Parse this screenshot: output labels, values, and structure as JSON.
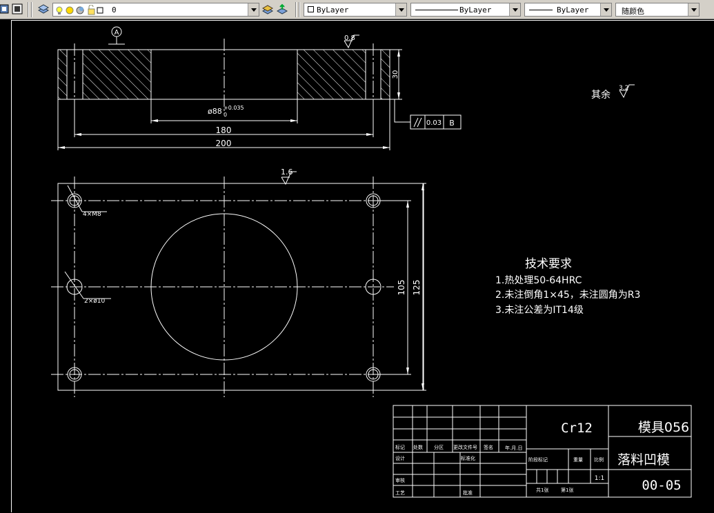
{
  "toolbar": {
    "layer_name": "0",
    "color_value": "ByLayer",
    "linetype_value": "ByLayer",
    "lineweight_value": "ByLayer",
    "plotstyle_value": "随颜色"
  },
  "drawing": {
    "datum_label": "A",
    "roughness_top": "0.8",
    "roughness_front": "1.6",
    "roughness_other_label": "其余",
    "roughness_other": "3.2",
    "dim_bore_main": "ø88",
    "dim_bore_tol_upper": "+0.035",
    "dim_bore_tol_lower": "0",
    "dim_180": "180",
    "dim_200": "200",
    "dim_30": "30",
    "tolerance_value": "0.03",
    "tolerance_datum": "B",
    "dim_105": "105",
    "dim_125": "125",
    "label_holes_thread": "4×M8",
    "label_holes_pin": "2×ø10",
    "tech_title": "技术要求",
    "tech_items": [
      "1.热处理50-64HRC",
      "2.未注倒角1×45，未注圆角为R3",
      "3.未注公差为IT14级"
    ]
  },
  "title_block": {
    "material": "Cr12",
    "drawing_code": "模具056",
    "part_name": "落料凹模",
    "drawing_number": "00-05",
    "scale": "1:1",
    "row_labels": {
      "biaoji": "标记",
      "chushu": "处数",
      "fenqu": "分区",
      "gengai": "更改文件号",
      "qianming": "签名",
      "riqi": "年.月.日",
      "sheji": "设计",
      "biaozhunhua": "标准化",
      "shenhe": "审核",
      "gongyi": "工艺",
      "pizhun": "批准",
      "jieduan": "阶段标记",
      "zhongliang": "重量",
      "bili": "比例",
      "zhang": "共1张",
      "dizhang": "第1张"
    }
  }
}
